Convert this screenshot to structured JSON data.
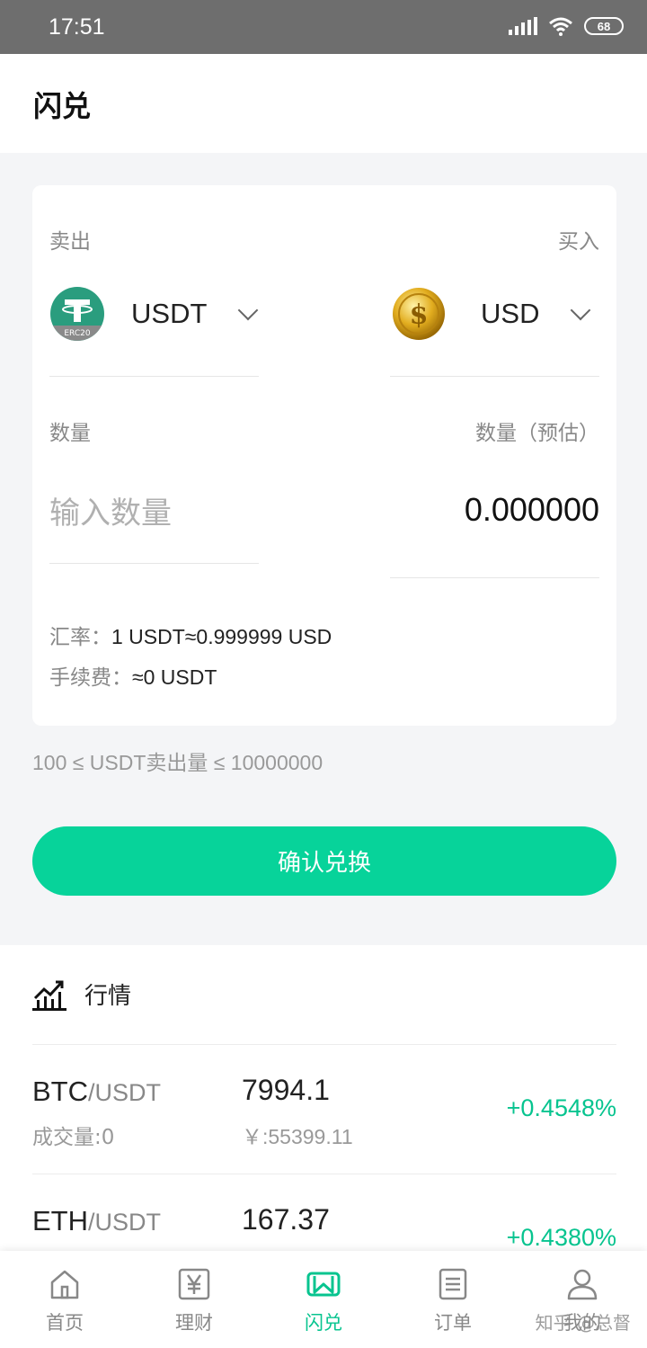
{
  "status_bar": {
    "time": "17:51",
    "battery": "68"
  },
  "header": {
    "title": "闪兑"
  },
  "exchange": {
    "sell_label": "卖出",
    "buy_label": "买入",
    "sell_coin": {
      "name": "USDT",
      "badge": "ERC20",
      "icon": "tether-erc20-icon"
    },
    "buy_coin": {
      "name": "USD",
      "icon": "gold-dollar-coin-icon"
    },
    "amount_label": "数量",
    "amount_estimate_label": "数量（预估）",
    "amount_placeholder": "输入数量",
    "amount_value": "",
    "estimated_amount": "0.000000",
    "rate_label": "汇率：",
    "rate_value": "1 USDT≈0.999999 USD",
    "fee_label": "手续费：",
    "fee_value": "≈0 USDT"
  },
  "limits_text": "100 ≤ USDT卖出量 ≤ 10000000",
  "confirm_label": "确认兑换",
  "market": {
    "title": "行情",
    "rows": [
      {
        "base": "BTC",
        "quote": "/USDT",
        "volume": "成交量:0",
        "price": "7994.1",
        "cny": "￥:55399.11",
        "change": "+0.4548%"
      },
      {
        "base": "ETH",
        "quote": "/USDT",
        "volume": "",
        "price": "167.37",
        "cny": "",
        "change": "+0.4380%"
      }
    ]
  },
  "tabs": [
    {
      "label": "首页",
      "icon": "home-icon"
    },
    {
      "label": "理财",
      "icon": "yen-icon"
    },
    {
      "label": "闪兑",
      "icon": "swap-icon",
      "active": true
    },
    {
      "label": "订单",
      "icon": "order-icon"
    },
    {
      "label": "我的",
      "icon": "user-icon"
    }
  ],
  "colors": {
    "accent": "#07d39a",
    "accent_text": "#07c48f",
    "status_bar": "#6e6e6e"
  },
  "watermark": "知乎 @总督"
}
